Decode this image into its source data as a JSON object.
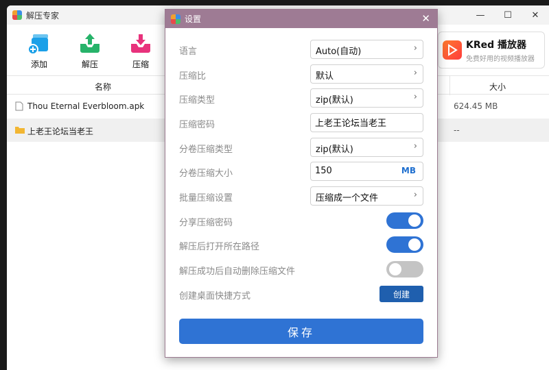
{
  "app": {
    "title": "解压专家",
    "toolbar": [
      {
        "label": "添加",
        "icon": "add-archive-icon",
        "color": "#1ba0e8"
      },
      {
        "label": "解压",
        "icon": "extract-icon",
        "color": "#27b36a"
      },
      {
        "label": "压缩",
        "icon": "compress-icon",
        "color": "#e8327c"
      }
    ],
    "ad": {
      "name": "KRed 播放器",
      "subtitle": "免费好用的视频播放器"
    },
    "table": {
      "headers": {
        "name": "名称",
        "size": "大小"
      },
      "rows": [
        {
          "name": "Thou Eternal Everbloom.apk",
          "size": "624.45 MB",
          "type": "file"
        },
        {
          "name": "上老王论坛当老王",
          "size": "--",
          "type": "folder"
        }
      ]
    },
    "window_controls": {
      "minimize": "—",
      "maximize": "☐",
      "close": "✕"
    }
  },
  "dialog": {
    "title": "设置",
    "close": "✕",
    "settings": {
      "language": {
        "label": "语言",
        "value": "Auto(自动)"
      },
      "ratio": {
        "label": "压缩比",
        "value": "默认"
      },
      "type": {
        "label": "压缩类型",
        "value": "zip(默认)"
      },
      "password": {
        "label": "压缩密码",
        "value": "上老王论坛当老王"
      },
      "split_type": {
        "label": "分卷压缩类型",
        "value": "zip(默认)"
      },
      "split_size": {
        "label": "分卷压缩大小",
        "value": "150",
        "unit": "MB"
      },
      "batch": {
        "label": "批量压缩设置",
        "value": "压缩成一个文件"
      },
      "share_password": {
        "label": "分享压缩密码",
        "enabled": true
      },
      "open_path": {
        "label": "解压后打开所在路径",
        "enabled": true
      },
      "auto_delete": {
        "label": "解压成功后自动删除压缩文件",
        "enabled": false
      },
      "shortcut": {
        "label": "创建桌面快捷方式",
        "button": "创建"
      }
    },
    "save_label": "保存"
  },
  "colors": {
    "accent": "#2f73d4",
    "dialog_title": "#9e7b94",
    "toggle_off": "#c4c4c4"
  }
}
